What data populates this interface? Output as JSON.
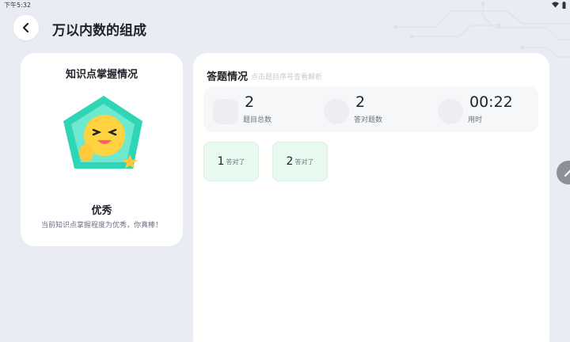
{
  "status_bar": {
    "time": "下午5:32"
  },
  "header": {
    "title": "万以内数的组成"
  },
  "mastery": {
    "title": "知识点掌握情况",
    "level": "优秀",
    "description": "当前知识点掌握程度为优秀，你真棒！"
  },
  "answers": {
    "title": "答题情况",
    "hint": "点击题目序号查看解析",
    "stats": [
      {
        "value": "2",
        "label": "题目总数",
        "icon": "doc-icon"
      },
      {
        "value": "2",
        "label": "答对题数",
        "icon": "smile-icon"
      },
      {
        "value": "00:22",
        "label": "用时",
        "icon": "clock-icon"
      }
    ],
    "questions": [
      {
        "number": "1",
        "status": "答对了"
      },
      {
        "number": "2",
        "status": "答对了"
      }
    ]
  },
  "colors": {
    "correct_bg": "#e8f9ef",
    "badge_teal": "#2fd6b6",
    "page_bg": "#e9edf3"
  }
}
